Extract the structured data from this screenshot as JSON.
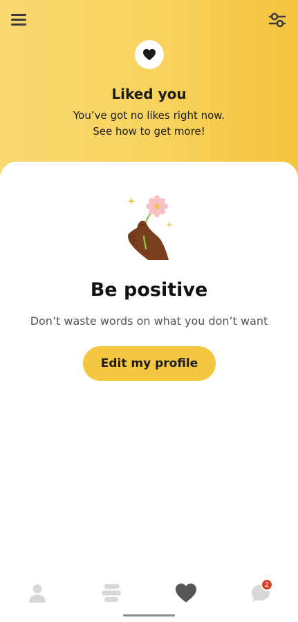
{
  "header": {
    "title": "Liked you",
    "subtitle_line1": "You’ve got no likes right now.",
    "subtitle_line2": "See how to get more!",
    "background_color": "#f8d25c",
    "menu_icon": "hamburger-menu-icon",
    "filter_icon": "filter-sliders-icon",
    "badge_icon": "heart-icon"
  },
  "empty_state": {
    "illustration": "hand-holding-flower-icon",
    "title": "Be positive",
    "subtitle": "Don’t waste words on what you don’t want",
    "button_label": "Edit my profile",
    "button_color": "#f5c63f"
  },
  "bottom_nav": {
    "items": [
      {
        "name": "profile",
        "icon": "person-icon",
        "active": false
      },
      {
        "name": "discover",
        "icon": "stacked-cards-icon",
        "active": false
      },
      {
        "name": "liked-you",
        "icon": "heart-icon",
        "active": true
      },
      {
        "name": "chats",
        "icon": "chat-bubble-icon",
        "active": false,
        "badge": "2"
      }
    ],
    "active_color": "#555555",
    "inactive_color": "#d8d8d8",
    "badge_color": "#d9402b"
  }
}
